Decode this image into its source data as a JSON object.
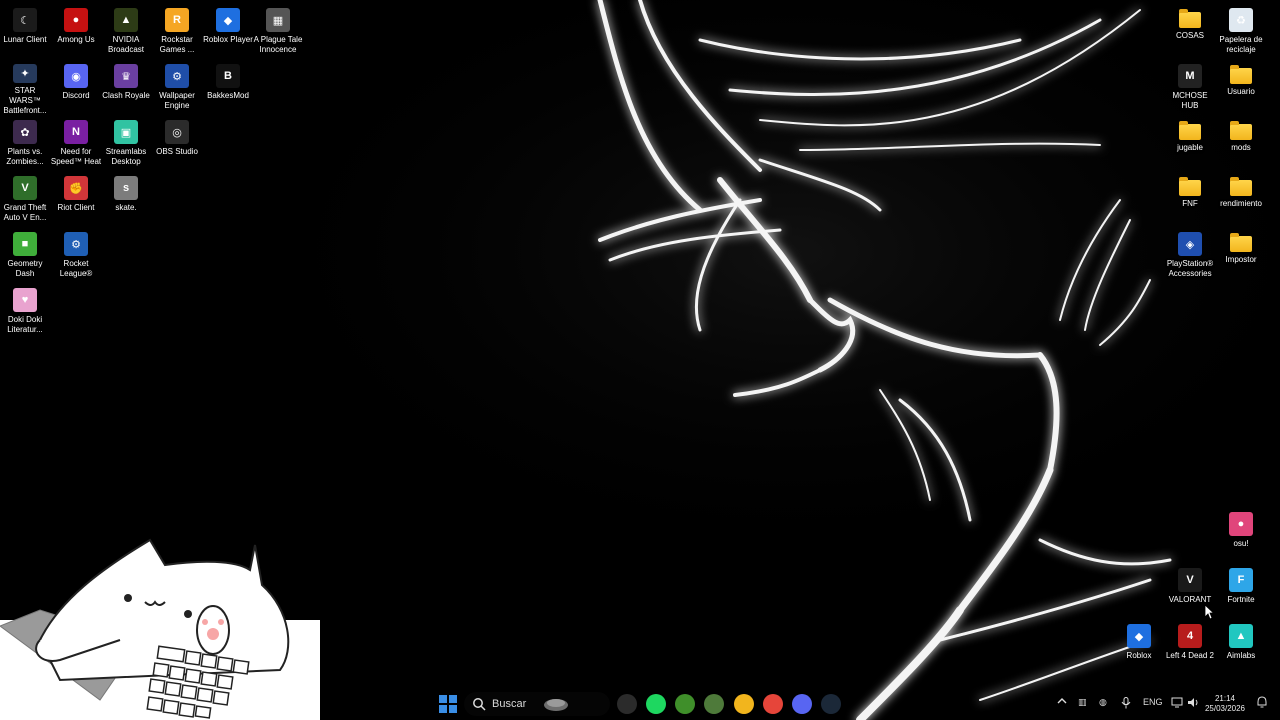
{
  "desktop": {
    "left_icons": [
      {
        "label": "Lunar Client",
        "icon": "lunar-client-icon",
        "color": "#1b1b1b",
        "glyph": "☾"
      },
      {
        "label": "Among Us",
        "icon": "among-us-icon",
        "color": "#c51111",
        "glyph": "●"
      },
      {
        "label": "NVIDIA Broadcast",
        "icon": "nvidia-broadcast-icon",
        "color": "#2d3b16",
        "glyph": "▲"
      },
      {
        "label": "Rockstar Games ...",
        "icon": "rockstar-games-icon",
        "color": "#f5a623",
        "glyph": "R"
      },
      {
        "label": "Roblox Player",
        "icon": "roblox-player-icon",
        "color": "#1e6fe0",
        "glyph": "◆"
      },
      {
        "label": "A Plague Tale Innocence",
        "icon": "plague-tale-icon",
        "color": "#555555",
        "glyph": "▦"
      },
      {
        "label": "STAR WARS™ Battlefront...",
        "icon": "star-wars-battlefront-icon",
        "color": "#263a5c",
        "glyph": "✦"
      },
      {
        "label": "Discord",
        "icon": "discord-icon",
        "color": "#5865f2",
        "glyph": "◉"
      },
      {
        "label": "Clash Royale",
        "icon": "clash-royale-icon",
        "color": "#6a3fa0",
        "glyph": "♛"
      },
      {
        "label": "Wallpaper Engine",
        "icon": "wallpaper-engine-icon",
        "color": "#1f4ea8",
        "glyph": "⚙"
      },
      {
        "label": "BakkesMod",
        "icon": "bakkesmod-icon",
        "color": "#111111",
        "glyph": "B"
      },
      {
        "label": "Plants vs. Zombies...",
        "icon": "plants-vs-zombies-icon",
        "color": "#3d2a4e",
        "glyph": "✿"
      },
      {
        "label": "Need for Speed™ Heat",
        "icon": "need-for-speed-heat-icon",
        "color": "#7a1fa2",
        "glyph": "N"
      },
      {
        "label": "Streamlabs Desktop",
        "icon": "streamlabs-desktop-icon",
        "color": "#31c3a2",
        "glyph": "▣"
      },
      {
        "label": "OBS Studio",
        "icon": "obs-studio-icon",
        "color": "#2b2b2b",
        "glyph": "◎"
      },
      {
        "label": "Grand Theft Auto V En...",
        "icon": "gta-v-icon",
        "color": "#2f6e2a",
        "glyph": "V"
      },
      {
        "label": "Riot Client",
        "icon": "riot-client-icon",
        "color": "#d13639",
        "glyph": "✊"
      },
      {
        "label": "skate.",
        "icon": "skate-icon",
        "color": "#7c7c7c",
        "glyph": "s"
      },
      {
        "label": "Geometry Dash",
        "icon": "geometry-dash-icon",
        "color": "#3fae3a",
        "glyph": "■"
      },
      {
        "label": "Rocket League®",
        "icon": "rocket-league-icon",
        "color": "#1f5fb5",
        "glyph": "⚙"
      },
      {
        "label": "Doki Doki Literatur...",
        "icon": "doki-doki-icon",
        "color": "#e9a3cf",
        "glyph": "♥"
      }
    ],
    "right_icons": [
      {
        "label": "COSAS",
        "icon": "folder-icon",
        "type": "folder"
      },
      {
        "label": "Papelera de reciclaje",
        "icon": "recycle-bin-icon",
        "type": "app",
        "color": "#dfe8f0",
        "glyph": "♻"
      },
      {
        "label": "MCHOSE HUB",
        "icon": "mchose-hub-icon",
        "type": "app",
        "color": "#222222",
        "glyph": "M"
      },
      {
        "label": "Usuario",
        "icon": "folder-icon",
        "type": "folder"
      },
      {
        "label": "jugable",
        "icon": "folder-icon",
        "type": "folder"
      },
      {
        "label": "mods",
        "icon": "folder-icon",
        "type": "folder"
      },
      {
        "label": "FNF",
        "icon": "folder-icon",
        "type": "folder"
      },
      {
        "label": "rendimiento",
        "icon": "folder-icon",
        "type": "folder"
      },
      {
        "label": "PlayStation® Accessories",
        "icon": "playstation-accessories-icon",
        "type": "app",
        "color": "#1f4fb0",
        "glyph": "◈"
      },
      {
        "label": "Impostor",
        "icon": "folder-icon",
        "type": "folder"
      },
      {
        "label": "osu!",
        "icon": "osu-icon",
        "type": "app",
        "color": "#e0457b",
        "glyph": "●"
      },
      {
        "label": "VALORANT",
        "icon": "valorant-icon",
        "type": "app",
        "color": "#1a1a1a",
        "glyph": "V"
      },
      {
        "label": "Fortnite",
        "icon": "fortnite-icon",
        "type": "app",
        "color": "#2ea6e8",
        "glyph": "F"
      },
      {
        "label": "Roblox",
        "icon": "roblox-icon",
        "type": "app",
        "color": "#1e6fe0",
        "glyph": "◆"
      },
      {
        "label": "Left 4 Dead 2",
        "icon": "left-4-dead-2-icon",
        "type": "app",
        "color": "#b71c1c",
        "glyph": "4"
      },
      {
        "label": "Aimlabs",
        "icon": "aimlabs-icon",
        "type": "app",
        "color": "#21c7c0",
        "glyph": "▲"
      }
    ]
  },
  "taskbar": {
    "search_placeholder": "Buscar",
    "pinned_apps": [
      {
        "name": "widget-icon",
        "color": "#6b6b6b"
      },
      {
        "name": "obs-studio-icon",
        "color": "#2b2b2b"
      },
      {
        "name": "spotify-icon",
        "color": "#1ed760"
      },
      {
        "name": "minecraft-icon",
        "color": "#3f8f2a"
      },
      {
        "name": "gallery-icon",
        "color": "#4e7a3a"
      },
      {
        "name": "file-explorer-icon",
        "color": "#f2b51d"
      },
      {
        "name": "chrome-icon",
        "color": "#e6453a"
      },
      {
        "name": "discord-icon",
        "color": "#5865f2"
      },
      {
        "name": "steam-icon",
        "color": "#1b2838"
      }
    ],
    "tray": {
      "language": "ENG",
      "time": "21:14",
      "date": "25/03/2026"
    }
  },
  "colors": {
    "accent": "#3a8ee6",
    "background": "#000000"
  }
}
